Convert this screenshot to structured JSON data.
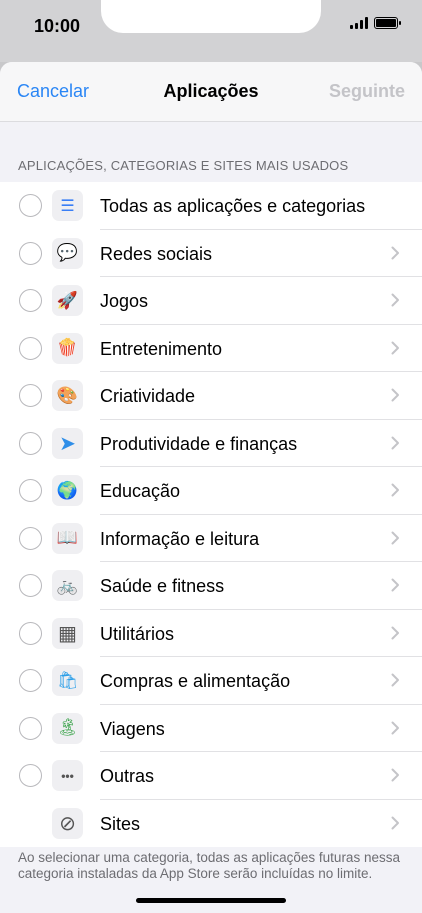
{
  "status_bar": {
    "time": "10:00"
  },
  "nav": {
    "cancel": "Cancelar",
    "title": "Aplicações",
    "next": "Seguinte"
  },
  "section_header": "APLICAÇÕES, CATEGORIAS E SITES MAIS USADOS",
  "items": [
    {
      "label": "Todas as aplicações e categorias",
      "icon": "layers-stack-icon",
      "glyph": "☰",
      "radio": true,
      "chevron": false
    },
    {
      "label": "Redes sociais",
      "icon": "chat-bubble-heart-icon",
      "glyph": "💬",
      "radio": true,
      "chevron": true
    },
    {
      "label": "Jogos",
      "icon": "rocket-icon",
      "glyph": "🚀",
      "radio": true,
      "chevron": true
    },
    {
      "label": "Entretenimento",
      "icon": "popcorn-icon",
      "glyph": "🍿",
      "radio": true,
      "chevron": true
    },
    {
      "label": "Criatividade",
      "icon": "palette-icon",
      "glyph": "🎨",
      "radio": true,
      "chevron": true
    },
    {
      "label": "Produtividade e finanças",
      "icon": "paper-plane-icon",
      "glyph": "➤",
      "radio": true,
      "chevron": true
    },
    {
      "label": "Educação",
      "icon": "globe-icon",
      "glyph": "🌍",
      "radio": true,
      "chevron": true
    },
    {
      "label": "Informação e leitura",
      "icon": "open-book-icon",
      "glyph": "📖",
      "radio": true,
      "chevron": true
    },
    {
      "label": "Saúde e fitness",
      "icon": "bicycle-icon",
      "glyph": "🚲",
      "radio": true,
      "chevron": true
    },
    {
      "label": "Utilitários",
      "icon": "calculator-icon",
      "glyph": "▦",
      "radio": true,
      "chevron": true
    },
    {
      "label": "Compras e alimentação",
      "icon": "shopping-bag-icon",
      "glyph": "🛍",
      "radio": true,
      "chevron": true
    },
    {
      "label": "Viagens",
      "icon": "palm-island-icon",
      "glyph": "🏝",
      "radio": true,
      "chevron": true
    },
    {
      "label": "Outras",
      "icon": "ellipsis-icon",
      "glyph": "•••",
      "radio": true,
      "chevron": true
    },
    {
      "label": "Sites",
      "icon": "compass-icon",
      "glyph": "⊘",
      "radio": false,
      "chevron": true
    }
  ],
  "footer_text": "Ao selecionar uma categoria, todas as aplicações futuras nessa categoria instaladas da App Store serão incluídas no limite.",
  "colors": {
    "accent": "#2a86f5",
    "disabled": "#c4c4c8"
  }
}
